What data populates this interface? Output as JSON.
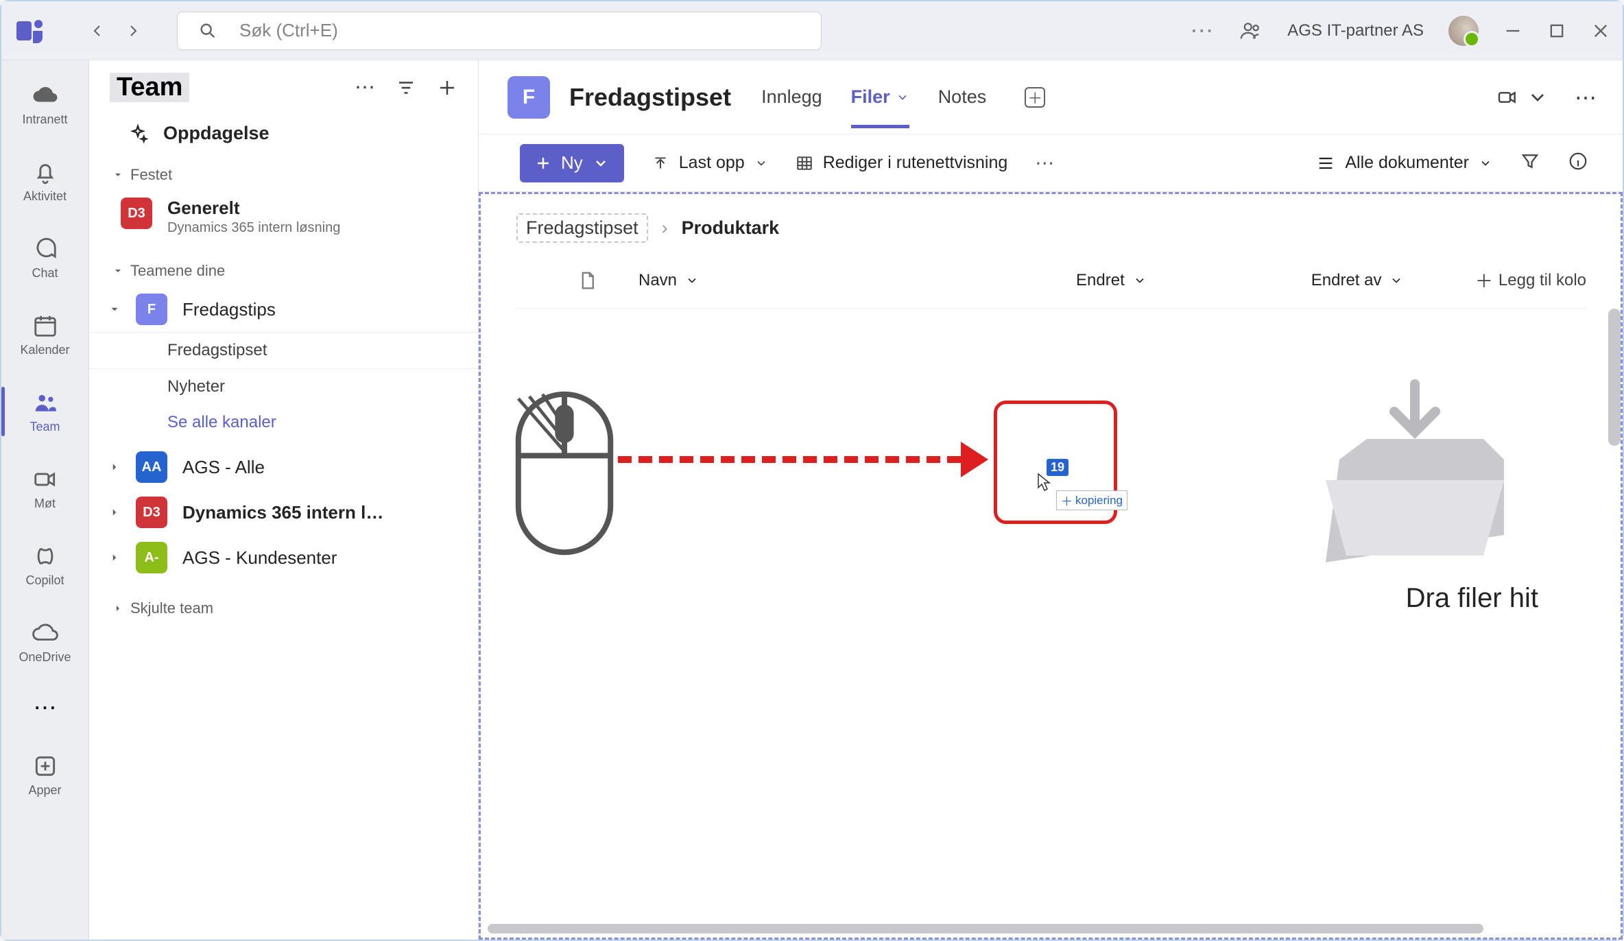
{
  "titlebar": {
    "search_placeholder": "Søk (Ctrl+E)",
    "org_name": "AGS IT-partner AS"
  },
  "rail": {
    "items": [
      {
        "id": "intranett",
        "label": "Intranett"
      },
      {
        "id": "aktivitet",
        "label": "Aktivitet"
      },
      {
        "id": "chat",
        "label": "Chat"
      },
      {
        "id": "kalender",
        "label": "Kalender"
      },
      {
        "id": "team",
        "label": "Team"
      },
      {
        "id": "mot",
        "label": "Møt"
      },
      {
        "id": "copilot",
        "label": "Copilot"
      },
      {
        "id": "onedrive",
        "label": "OneDrive"
      }
    ],
    "apps_label": "Apper"
  },
  "panel": {
    "title": "Team",
    "discover_label": "Oppdagelse",
    "pinned_label": "Festet",
    "pinned": {
      "name": "Generelt",
      "sub": "Dynamics 365 intern løsning",
      "badge": "D3",
      "color": "#d13438"
    },
    "your_teams_label": "Teamene dine",
    "teams": [
      {
        "badge": "F",
        "color": "#7b83eb",
        "name": "Fredagstips",
        "channels": [
          {
            "label": "Fredagstipset",
            "active": true
          },
          {
            "label": "Nyheter"
          },
          {
            "label": "Se alle kanaler",
            "link": true
          }
        ]
      },
      {
        "badge": "AA",
        "color": "#2564cf",
        "name": "AGS - Alle"
      },
      {
        "badge": "D3",
        "color": "#d13438",
        "name": "Dynamics 365 intern l…",
        "bold": true
      },
      {
        "badge": "A-",
        "color": "#8cbd18",
        "name": "AGS - Kundesenter"
      }
    ],
    "hidden_label": "Skjulte team"
  },
  "channel_header": {
    "avatar_letter": "F",
    "title": "Fredagstipset",
    "tabs": [
      {
        "label": "Innlegg"
      },
      {
        "label": "Filer",
        "active": true,
        "has_chevron": true
      },
      {
        "label": "Notes"
      }
    ]
  },
  "files_toolbar": {
    "new_label": "Ny",
    "upload_label": "Last opp",
    "edit_grid_label": "Rediger i rutenettvisning",
    "view_label": "Alle dokumenter"
  },
  "breadcrumb": {
    "root": "Fredagstipset",
    "current": "Produktark"
  },
  "columns": {
    "name": "Navn",
    "modified": "Endret",
    "modified_by": "Endret av",
    "add": "Legg til kolo"
  },
  "dropzone": {
    "text": "Dra filer hit",
    "badge": "19",
    "copy_label": "kopiering"
  }
}
